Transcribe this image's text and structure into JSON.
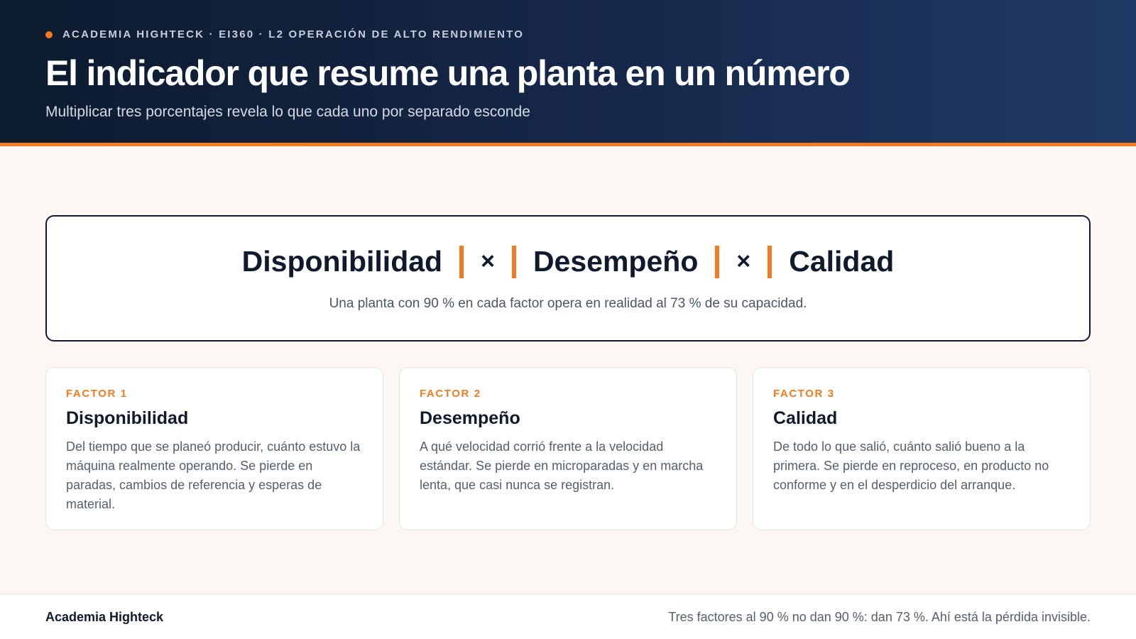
{
  "header": {
    "eyebrow": "ACADEMIA HIGHTECK · EI360 · L2 OPERACIÓN DE ALTO RENDIMIENTO",
    "title": "El indicador que resume una planta en un número",
    "subtitle": "Multiplicar tres porcentajes revela lo que cada uno por separado esconde"
  },
  "formula": {
    "term1": "Disponibilidad",
    "operator1": "×",
    "term2": "Desempeño",
    "operator2": "×",
    "term3": "Calidad",
    "note": "Una planta con 90 % en cada factor opera en realidad al 73 % de su capacidad."
  },
  "cards": [
    {
      "tag": "FACTOR 1",
      "title": "Disponibilidad",
      "body": "Del tiempo que se planeó producir, cuánto estuvo la máquina realmente operando. Se pierde en paradas, cambios de referencia y esperas de material."
    },
    {
      "tag": "FACTOR 2",
      "title": "Desempeño",
      "body": "A qué velocidad corrió frente a la velocidad estándar. Se pierde en microparadas y en marcha lenta, que casi nunca se registran."
    },
    {
      "tag": "FACTOR 3",
      "title": "Calidad",
      "body": "De todo lo que salió, cuánto salió bueno a la primera. Se pierde en reproceso, en producto no conforme y en el desperdicio del arranque."
    }
  ],
  "footer": {
    "brand": "Academia Highteck",
    "note": "Tres factores al 90 % no dan 90 %: dan 73 %. Ahí está la pérdida invisible."
  },
  "colors": {
    "accent": "#f47b20",
    "navy": "#0f1b2d",
    "background": "#fdf7f3"
  }
}
